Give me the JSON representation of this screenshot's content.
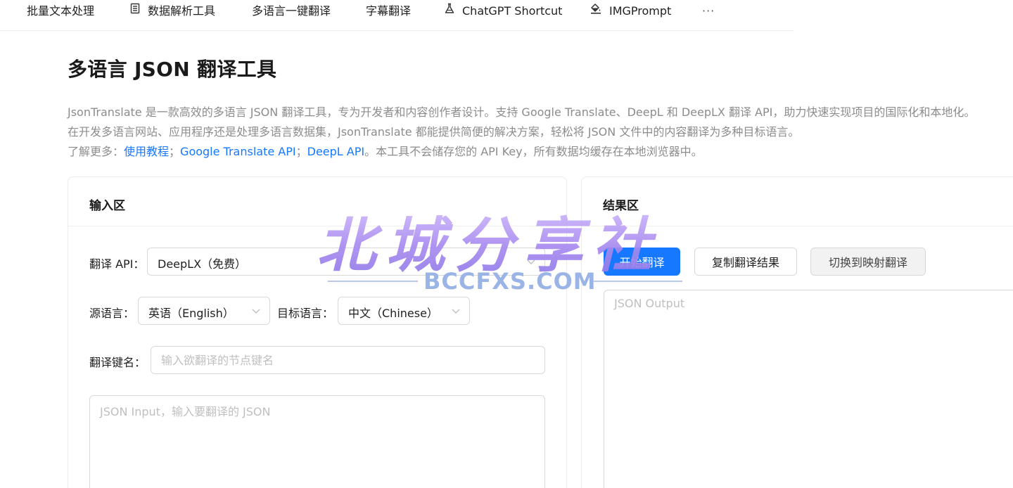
{
  "nav": {
    "items": [
      {
        "label": "批量文本处理",
        "icon": null
      },
      {
        "label": "数据解析工具",
        "icon": "document-list-icon"
      },
      {
        "label": "多语言一键翻译",
        "icon": null
      },
      {
        "label": "字幕翻译",
        "icon": null
      },
      {
        "label": "ChatGPT Shortcut",
        "icon": "flask-icon"
      },
      {
        "label": "IMGPrompt",
        "icon": "paint-bucket-icon"
      }
    ],
    "more": "···"
  },
  "page": {
    "title": "多语言 JSON 翻译工具",
    "desc_line1": "JsonTranslate 是一款高效的多语言 JSON 翻译工具，专为开发者和内容创作者设计。支持 Google Translate、DeepL 和 DeepLX 翻译 API，助力快速实现项目的国际化和本地化。",
    "desc_line2": "在开发多语言网站、应用程序还是处理多语言数据集，JsonTranslate 都能提供简便的解决方案，轻松将 JSON 文件中的内容翻译为多种目标语言。",
    "learn_more": "了解更多：",
    "link_tutorial": "使用教程",
    "sep1": "；",
    "link_google": "Google Translate API",
    "sep2": "；",
    "link_deepl": "DeepL API",
    "note": "。本工具不会储存您的 API Key，所有数据均缓存在本地浏览器中。"
  },
  "input_panel": {
    "title": "输入区",
    "api_label": "翻译 API：",
    "api_value": "DeepLX（免费）",
    "source_label": "源语言：",
    "source_value": "英语（English）",
    "target_label": "目标语言：",
    "target_value": "中文（Chinese）",
    "key_label": "翻译键名：",
    "key_placeholder": "输入欲翻译的节点键名",
    "json_placeholder": "JSON Input，输入要翻译的 JSON"
  },
  "result_panel": {
    "title": "结果区",
    "start_button": "开始翻译",
    "copy_button": "复制翻译结果",
    "switch_button": "切换到映射翻译",
    "output_placeholder": "JSON Output"
  },
  "watermark": {
    "text_cn": "北城分享社",
    "text_en": "BCCFXS.COM"
  },
  "colors": {
    "primary": "#1677ff",
    "link": "#1677ff",
    "muted_text": "#8c8c8c",
    "border": "#d9d9d9"
  }
}
